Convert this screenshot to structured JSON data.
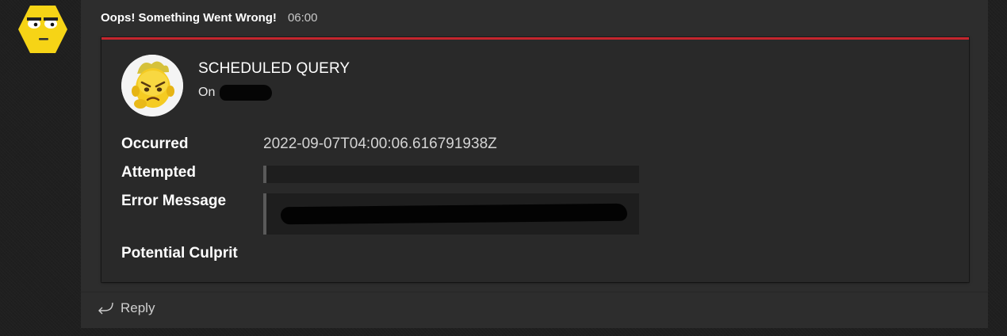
{
  "message": {
    "sender": "Oops! Something Went Wrong!",
    "time": "06:00"
  },
  "card": {
    "title": "SCHEDULED QUERY",
    "subtitle_prefix": "On",
    "facts": [
      {
        "label": "Occurred",
        "value": "2022-09-07T04:00:06.616791938Z"
      },
      {
        "label": "Attempted",
        "value": ""
      },
      {
        "label": "Error Message",
        "value": ""
      },
      {
        "label": "Potential Culprit",
        "value": ""
      }
    ],
    "accent_color": "#c4262e"
  },
  "reply": {
    "label": "Reply"
  },
  "icons": {
    "sender_avatar": "hexagon-face-icon",
    "card_avatar": "angry-face-icon",
    "reply": "reply-arrow-icon"
  }
}
